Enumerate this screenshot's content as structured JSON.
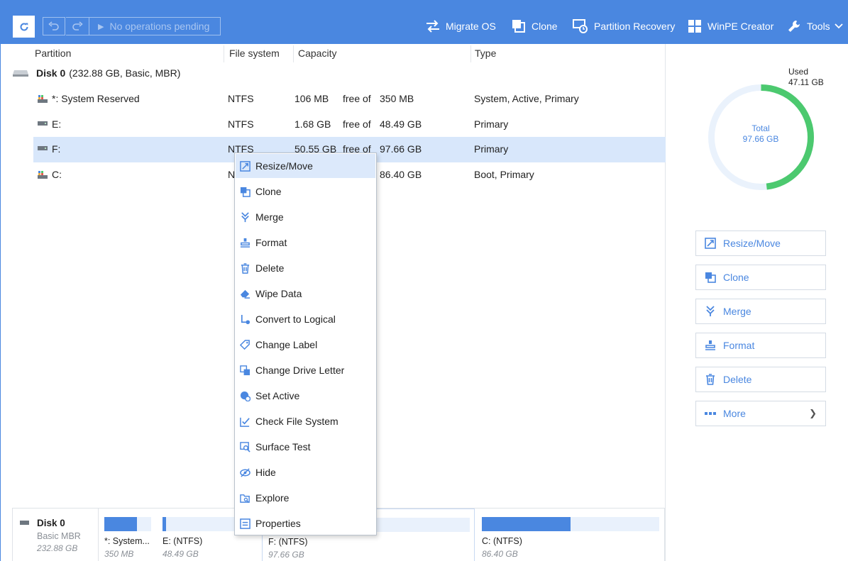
{
  "toolbar": {
    "pending_label": "No operations pending",
    "items": [
      {
        "label": "Migrate OS",
        "icon": "migrate-icon"
      },
      {
        "label": "Clone",
        "icon": "clone-icon"
      },
      {
        "label": "Partition Recovery",
        "icon": "recovery-icon"
      },
      {
        "label": "WinPE Creator",
        "icon": "windows-icon"
      },
      {
        "label": "Tools",
        "icon": "wrench-icon"
      }
    ]
  },
  "table": {
    "headers": {
      "partition": "Partition",
      "filesystem": "File system",
      "capacity": "Capacity",
      "type": "Type"
    },
    "disk": {
      "name": "Disk 0",
      "info": "(232.88 GB, Basic, MBR)"
    },
    "rows": [
      {
        "name": "*: System Reserved",
        "fs": "NTFS",
        "used": "106 MB",
        "free_of": "free of",
        "total": "350 MB",
        "type": "System, Active, Primary"
      },
      {
        "name": "E:",
        "fs": "NTFS",
        "used": "1.68 GB",
        "free_of": "free of",
        "total": "48.49 GB",
        "type": "Primary"
      },
      {
        "name": "F:",
        "fs": "NTFS",
        "used": "50.55 GB",
        "free_of": "free of",
        "total": "97.66 GB",
        "type": "Primary"
      },
      {
        "name": "C:",
        "fs": "N",
        "used": "",
        "free_of": "",
        "total": "86.40 GB",
        "type": "Boot, Primary"
      }
    ]
  },
  "context_menu": {
    "items": [
      {
        "label": "Resize/Move",
        "icon": "resize-icon"
      },
      {
        "label": "Clone",
        "icon": "clone-icon"
      },
      {
        "label": "Merge",
        "icon": "merge-icon"
      },
      {
        "label": "Format",
        "icon": "format-icon"
      },
      {
        "label": "Delete",
        "icon": "trash-icon"
      },
      {
        "label": "Wipe Data",
        "icon": "eraser-icon"
      },
      {
        "label": "Convert to Logical",
        "icon": "convert-icon"
      },
      {
        "label": "Change Label",
        "icon": "tag-icon"
      },
      {
        "label": "Change Drive Letter",
        "icon": "drive-letter-icon"
      },
      {
        "label": "Set Active",
        "icon": "set-active-icon"
      },
      {
        "label": "Check File System",
        "icon": "check-icon"
      },
      {
        "label": "Surface Test",
        "icon": "surface-test-icon"
      },
      {
        "label": "Hide",
        "icon": "hide-icon"
      },
      {
        "label": "Explore",
        "icon": "folder-search-icon"
      },
      {
        "label": "Properties",
        "icon": "properties-icon"
      }
    ]
  },
  "right_panel": {
    "used_label": "Used",
    "used_value": "47.11 GB",
    "total_label": "Total",
    "total_value": "97.66 GB",
    "used_fraction": 0.482,
    "colors": {
      "used": "#4cc96f",
      "free": "#eaf2fc",
      "accent": "#4a87e0"
    },
    "actions": [
      {
        "label": "Resize/Move",
        "icon": "resize-icon"
      },
      {
        "label": "Clone",
        "icon": "clone-icon"
      },
      {
        "label": "Merge",
        "icon": "merge-icon"
      },
      {
        "label": "Format",
        "icon": "format-icon"
      },
      {
        "label": "Delete",
        "icon": "trash-icon"
      },
      {
        "label": "More",
        "icon": "more-dots-icon"
      }
    ]
  },
  "disk_map": {
    "disk": {
      "name": "Disk 0",
      "type": "Basic MBR",
      "size": "232.88 GB"
    },
    "partitions": [
      {
        "label": "*: System...",
        "size": "350 MB",
        "used_fraction": 0.7
      },
      {
        "label": "E: (NTFS)",
        "size": "48.49 GB",
        "used_fraction": 0.04
      },
      {
        "label": "F: (NTFS)",
        "size": "97.66 GB",
        "used_fraction": 0.48
      },
      {
        "label": "C: (NTFS)",
        "size": "86.40 GB",
        "used_fraction": 0.5
      }
    ]
  }
}
